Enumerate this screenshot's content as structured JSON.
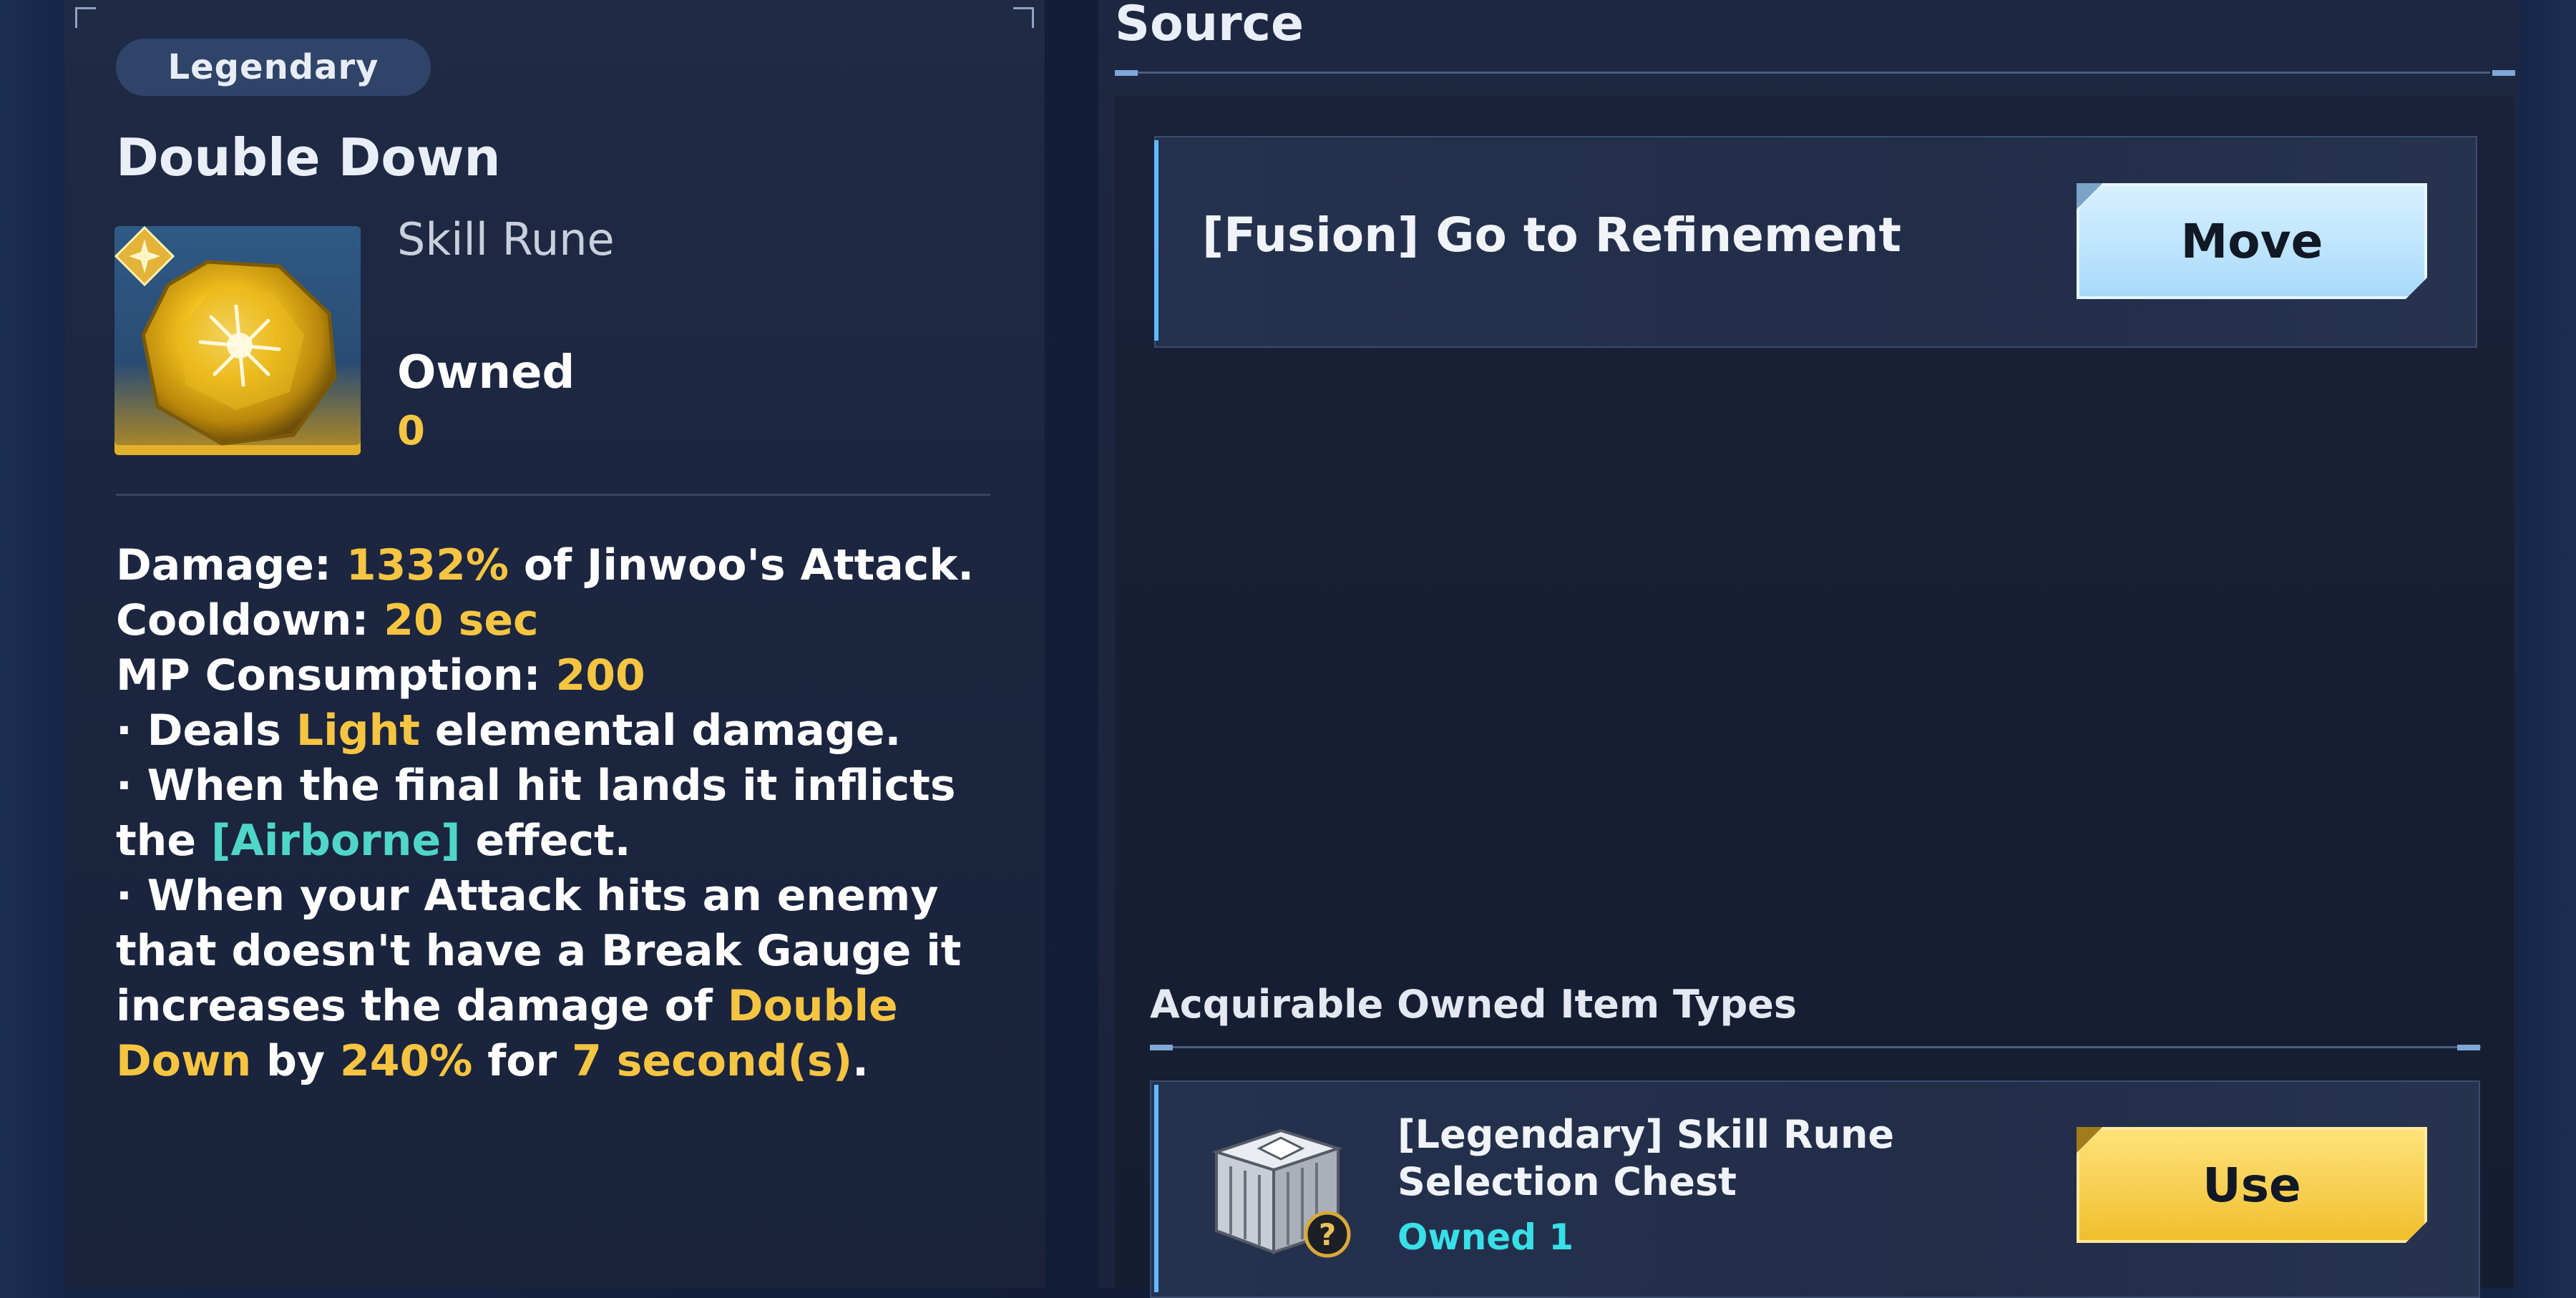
{
  "item": {
    "rarity": "Legendary",
    "name": "Double Down",
    "type": "Skill Rune",
    "owned_label": "Owned",
    "owned_count": "0"
  },
  "description": {
    "damage": {
      "prefix": "Damage: ",
      "value": "1332%",
      "suffix": " of Jinwoo's Attack."
    },
    "cooldown": {
      "prefix": "Cooldown: ",
      "value": "20 sec"
    },
    "mp": {
      "prefix": "MP Consumption: ",
      "value": "200"
    },
    "b1": {
      "prefix": "· Deals ",
      "element": "Light",
      "suffix": " elemental damage."
    },
    "b2": {
      "prefix": "· When the final hit lands it inflicts the ",
      "effect": "[Airborne]",
      "suffix": " effect."
    },
    "b3": {
      "prefix": "· When your Attack hits an enemy that doesn't have a Break Gauge it increases the damage of ",
      "skill": "Double Down",
      "mid1": " by ",
      "amount": "240%",
      "mid2": " for ",
      "duration": "7 second(s)",
      "end": "."
    }
  },
  "source": {
    "title": "Source",
    "entries": [
      {
        "label": "[Fusion] Go to Refinement",
        "button": "Move"
      }
    ]
  },
  "acquirable": {
    "title": "Acquirable Owned Item Types",
    "items": [
      {
        "name": "[Legendary] Skill Rune Selection Chest",
        "owned": "Owned 1",
        "button": "Use"
      }
    ]
  },
  "colors": {
    "highlight_yellow": "#f5c542",
    "highlight_teal": "#4fd6c9",
    "move_button": "#a8daf9",
    "use_button": "#f0bf2e",
    "owned_teal": "#38e0e8"
  },
  "icons": {
    "rune": "gold-gem-icon",
    "rune_badge": "star-badge-icon",
    "chest": "silver-chest-icon",
    "chest_badge": "question-mark-icon"
  }
}
